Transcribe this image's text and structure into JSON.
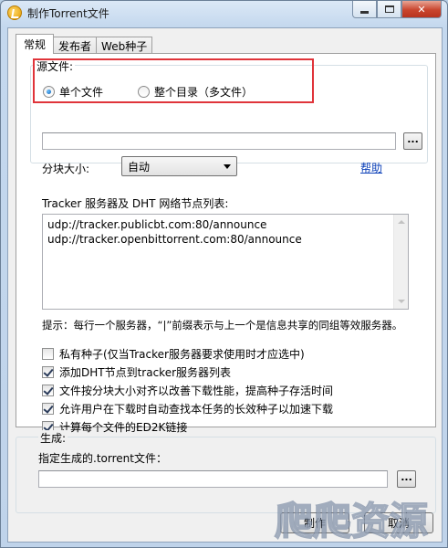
{
  "window": {
    "title": "制作Torrent文件"
  },
  "tabs": [
    {
      "label": "常规"
    },
    {
      "label": "发布者"
    },
    {
      "label": "Web种子"
    }
  ],
  "source": {
    "group_label": "源文件:",
    "single_file": "单个文件",
    "whole_dir": "整个目录（多文件）",
    "selected": "single_file",
    "path_value": "",
    "browse_label": "..."
  },
  "piece": {
    "label": "分块大小:",
    "value": "自动",
    "help_link": "帮助"
  },
  "tracker": {
    "label": "Tracker 服务器及 DHT 网络节点列表:",
    "lines": [
      "udp://tracker.publicbt.com:80/announce",
      "udp://tracker.openbittorrent.com:80/announce"
    ],
    "hint": "提示：每行一个服务器，“|”前缀表示与上一个是信息共享的同组等效服务器。"
  },
  "options": [
    {
      "label": "私有种子(仅当Tracker服务器要求使用时才应选中)",
      "checked": false
    },
    {
      "label": "添加DHT节点到tracker服务器列表",
      "checked": true
    },
    {
      "label": "文件按分块大小对齐以改善下载性能，提高种子存活时间",
      "checked": true
    },
    {
      "label": "允许用户在下载时自动查找本任务的长效种子以加速下载",
      "checked": true
    },
    {
      "label": "计算每个文件的ED2K链接",
      "checked": true
    }
  ],
  "generate": {
    "group_label": "生成:",
    "label": "指定生成的.torrent文件：",
    "path_value": "",
    "browse_label": "..."
  },
  "buttons": {
    "create": "制作",
    "cancel": "取消"
  },
  "watermark": {
    "text": "爬爬资源"
  },
  "colors": {
    "highlight": "#e0343a",
    "link": "#0b3fb8",
    "accent": "#0a5fb4"
  }
}
